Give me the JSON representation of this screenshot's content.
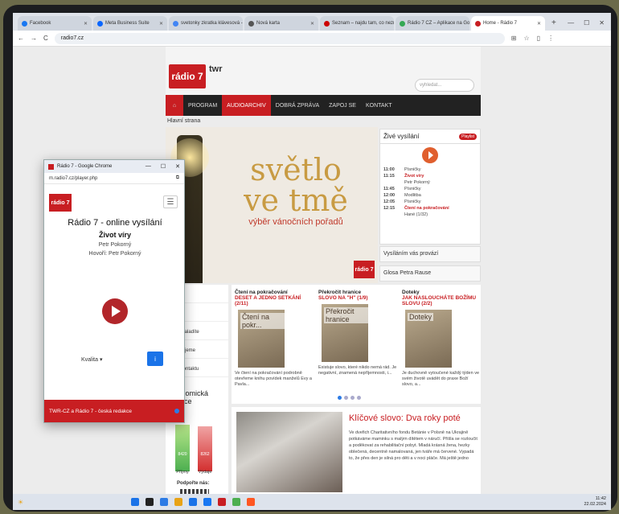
{
  "browser": {
    "tabs": [
      {
        "label": "Facebook",
        "color": "#1877f2",
        "active": false
      },
      {
        "label": "Meta Business Suite",
        "color": "#0866ff",
        "active": false
      },
      {
        "label": "svetonky zkratka klávesová - V",
        "color": "#4285f4",
        "active": false
      },
      {
        "label": "Nová karta",
        "color": "#555555",
        "active": false
      },
      {
        "label": "Seznam – najdu tam, co neznám",
        "color": "#cc0000",
        "active": false
      },
      {
        "label": "Rádio 7 CZ – Aplikace na Goog",
        "color": "#34a853",
        "active": false
      },
      {
        "label": "Home - Rádio 7",
        "color": "#c81e22",
        "active": true
      }
    ],
    "url": "radio7.cz",
    "nav_icons": [
      "←",
      "→",
      "C"
    ]
  },
  "site": {
    "logo": "rádio 7",
    "logo_partner": "twr",
    "search_placeholder": "vyhledat...",
    "nav": [
      {
        "label": "⌂",
        "active": false,
        "home": true
      },
      {
        "label": "PROGRAM",
        "active": false
      },
      {
        "label": "AUDIOARCHIV",
        "active": true
      },
      {
        "label": "DOBRÁ ZPRÁVA",
        "active": false
      },
      {
        "label": "ZAPOJ SE",
        "active": false
      },
      {
        "label": "KONTAKT",
        "active": false
      }
    ],
    "breadcrumb": "Hlavní strana",
    "banner": {
      "title_line1": "světlo",
      "title_line2": "ve tmě",
      "subtitle": "výběr vánočních pořadů",
      "logo": "rádio 7"
    },
    "live": {
      "title": "Živé vysílání",
      "badge": "Playlist",
      "schedule": [
        {
          "time": "11:00",
          "name": "Písničky",
          "hl": false
        },
        {
          "time": "11:15",
          "name": "Život víry",
          "hl": true
        },
        {
          "time": "",
          "name": "Petr Pokorný",
          "hl": false
        },
        {
          "time": "11:45",
          "name": "Písničky",
          "hl": false
        },
        {
          "time": "12:00",
          "name": "Modlitba",
          "hl": false
        },
        {
          "time": "12:05",
          "name": "Písničky",
          "hl": false
        },
        {
          "time": "12:15",
          "name": "Čtení na pokračování",
          "hl": true
        },
        {
          "time": "",
          "name": "Hané (1/32)",
          "hl": false
        }
      ]
    },
    "side_buttons": [
      "Vysíláním vás provází",
      "Glosa Petra Rause"
    ],
    "left_menu": [
      "...álení",
      "...ás",
      "...nás naladíte",
      "...oručujeme",
      "...e v kontaktu"
    ],
    "economy": {
      "title": "Ekonomická bilance",
      "income": "8420",
      "expenses": "8262",
      "income_label": "Příjmy",
      "expenses_label": "Výdaje",
      "support": "Podpořte nás:"
    },
    "news": [
      {
        "head": "Čtení na pokračování",
        "title": "DESET A JEDNO SETKÁNÍ (2/11)",
        "img": "Čtení na pokr...",
        "text": "Ve čtení na pokračování podrobně otevřeme knihu povídek manželů Evy a Pavla..."
      },
      {
        "head": "Překročit hranice",
        "title": "SLOVO NA \"H\" (1/9)",
        "img": "Překročit hranice",
        "text": "Existuje slovo, které nikdo nemá rád. Je negativní, znamená nepříjemnosti, i..."
      },
      {
        "head": "Doteky",
        "title": "JAK NASLOUCHÁTE BOŽÍMU SLOVU (2/2)",
        "img": "Doteky",
        "text": "Je duchovně vytoučené každý týden ve svém životě uvádět do praxe Boží slovo, a..."
      }
    ],
    "keyword": {
      "title": "Klíčové slovo: Dva roky poté",
      "text": "Ve dvefich Charitativního fondu Betánie v Polsně na Ukrajině potkáváme maminku s malým dítětem v náručí. Přišla se rozloučit a poděkovat za rehabilitační pobyt. Mladá krásná žena, hezky oblečená, decentně namalovaná, jen tváře má červené. Vypadá to, že přes den je silná pro děti a v noci pláče. Má ještě jedno"
    }
  },
  "popup": {
    "window_title": "Rádio 7 - Google Chrome",
    "url": "m.radio7.cz/player.php",
    "logo": "rádio 7",
    "heading": "Rádio 7 - online vysílání",
    "program": "Život víry",
    "host": "Petr Pokorný",
    "speaker": "Hovoří: Petr Pokorný",
    "quality": "Kvalita ▾",
    "info": "i",
    "footer": "TWR-CZ a Rádio 7 - česká redakce"
  },
  "taskbar": {
    "icon_colors": [
      "#1a73e8",
      "#222222",
      "#2c7be5",
      "#e8a317",
      "#1a73e8",
      "#1877f2",
      "#c81e22",
      "#4caf50",
      "#ff5722"
    ],
    "time": "11:42",
    "date": "22.02.2024"
  }
}
